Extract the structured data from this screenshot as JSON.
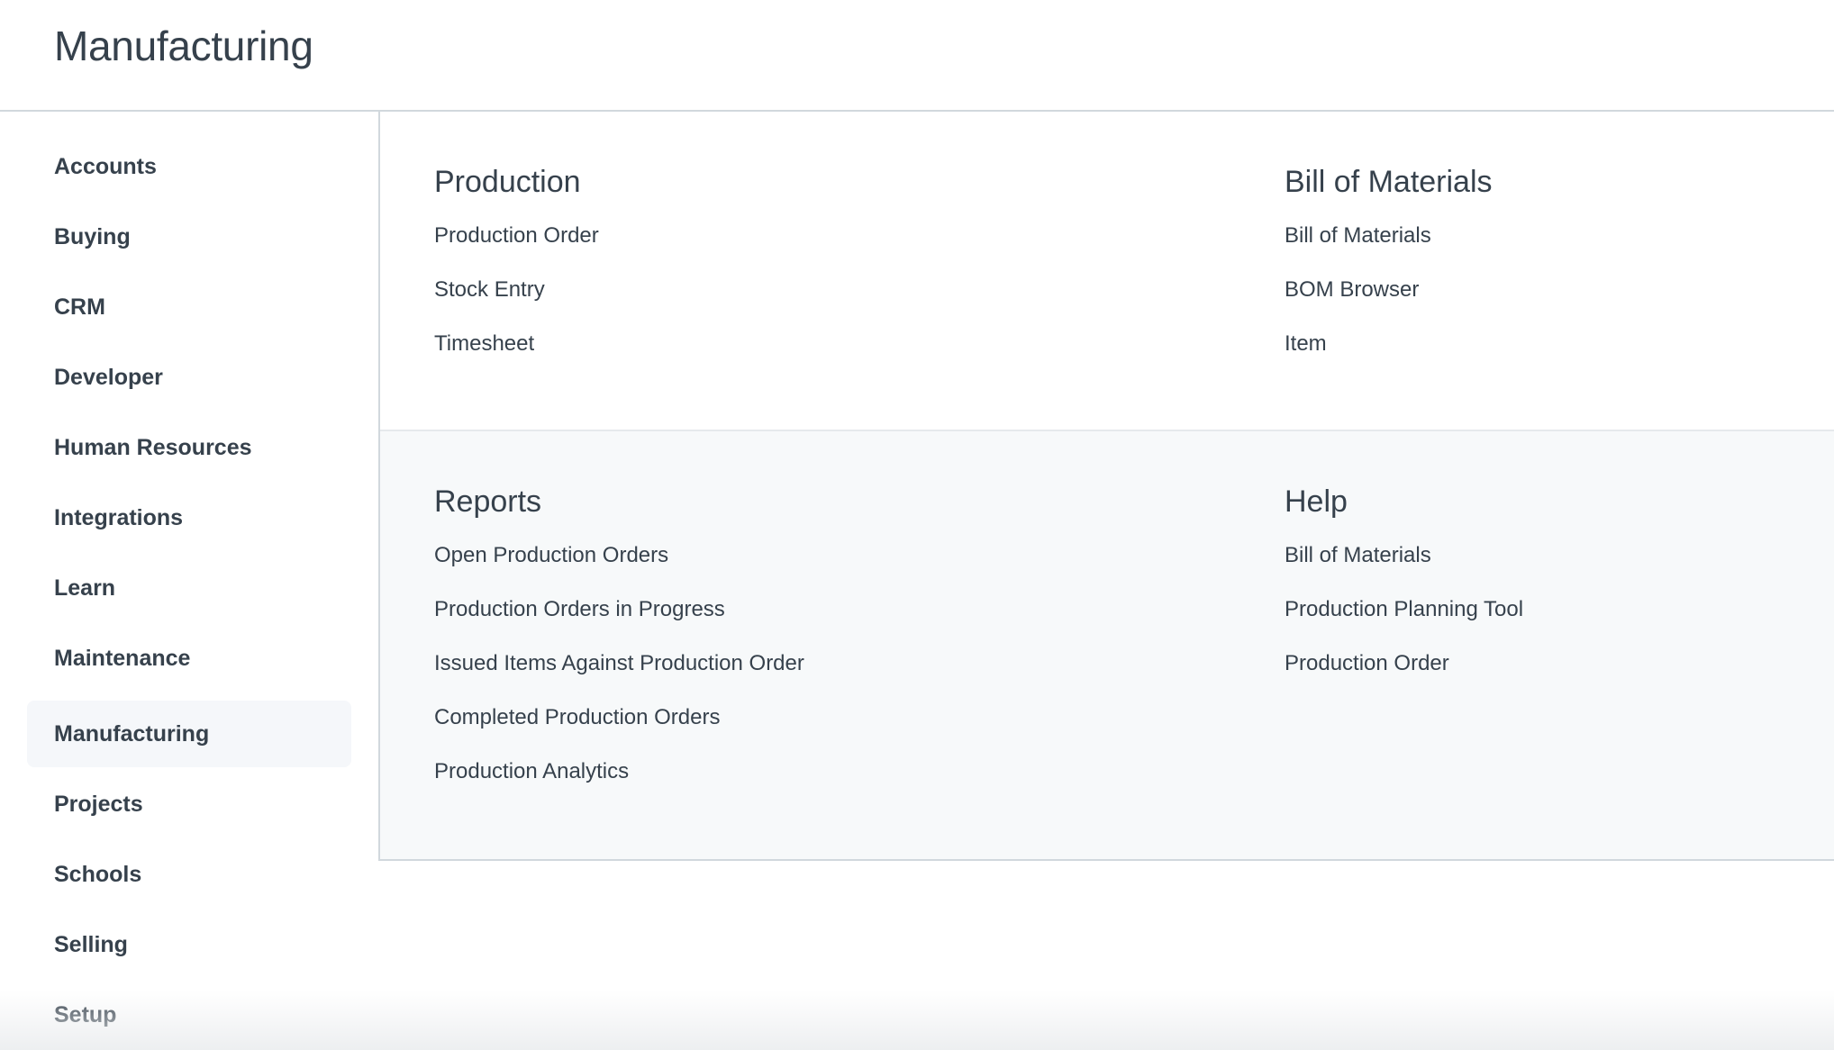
{
  "page": {
    "title": "Manufacturing"
  },
  "sidebar": {
    "items": [
      {
        "label": "Accounts"
      },
      {
        "label": "Buying"
      },
      {
        "label": "CRM"
      },
      {
        "label": "Developer"
      },
      {
        "label": "Human Resources"
      },
      {
        "label": "Integrations"
      },
      {
        "label": "Learn"
      },
      {
        "label": "Maintenance"
      },
      {
        "label": "Manufacturing",
        "active": true
      },
      {
        "label": "Projects"
      },
      {
        "label": "Schools"
      },
      {
        "label": "Selling"
      },
      {
        "label": "Setup"
      }
    ]
  },
  "sections": {
    "production": {
      "title": "Production",
      "links": [
        "Production Order",
        "Stock Entry",
        "Timesheet"
      ]
    },
    "bill_of_materials": {
      "title": "Bill of Materials",
      "links": [
        "Bill of Materials",
        "BOM Browser",
        "Item"
      ]
    },
    "reports": {
      "title": "Reports",
      "links": [
        "Open Production Orders",
        "Production Orders in Progress",
        "Issued Items Against Production Order",
        "Completed Production Orders",
        "Production Analytics"
      ]
    },
    "help": {
      "title": "Help",
      "links": [
        "Bill of Materials",
        "Production Planning Tool",
        "Production Order"
      ]
    }
  },
  "colors": {
    "text": "#36414c",
    "border": "#d1d8dd",
    "active_bg": "#f5f7fa",
    "section_alt_bg": "#f7f9fa"
  }
}
